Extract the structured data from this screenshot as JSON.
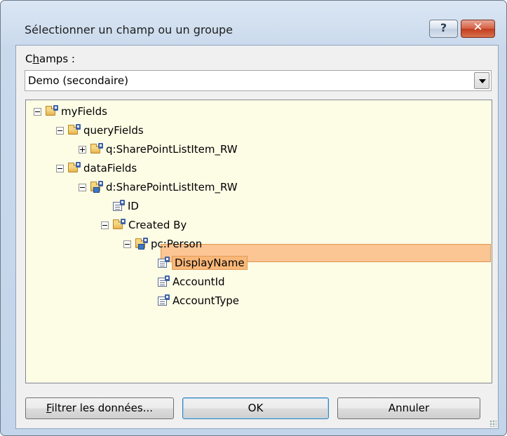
{
  "dialog": {
    "title": "Sélectionner un champ ou un groupe",
    "help_label": "?",
    "close_label": "✕"
  },
  "fields": {
    "label_prefix": "C",
    "label_underlined": "h",
    "label_suffix": "amps :",
    "selected_source": "Demo (secondaire)"
  },
  "tree": {
    "nodes": [
      {
        "label": "myFields",
        "level": 0,
        "expander": "minus",
        "icon": "folder-icon"
      },
      {
        "label": "queryFields",
        "level": 1,
        "expander": "minus",
        "icon": "folder-icon"
      },
      {
        "label": "q:SharePointListItem_RW",
        "level": 2,
        "expander": "plus",
        "icon": "folder-icon"
      },
      {
        "label": "dataFields",
        "level": 1,
        "expander": "minus",
        "icon": "folder-icon"
      },
      {
        "label": "d:SharePointListItem_RW",
        "level": 2,
        "expander": "minus",
        "icon": "folder-link-icon"
      },
      {
        "label": "ID",
        "level": 3,
        "expander": "none",
        "icon": "field-icon"
      },
      {
        "label": "Created By",
        "level": 3,
        "expander": "minus",
        "icon": "folder-icon"
      },
      {
        "label": "pc:Person",
        "level": 4,
        "expander": "minus",
        "icon": "folder-link-icon"
      },
      {
        "label": "DisplayName",
        "level": 5,
        "expander": "none",
        "icon": "field-icon",
        "selected": true
      },
      {
        "label": "AccountId",
        "level": 5,
        "expander": "none",
        "icon": "field-icon"
      },
      {
        "label": "AccountType",
        "level": 5,
        "expander": "none",
        "icon": "field-icon"
      }
    ]
  },
  "buttons": {
    "filter_first": "F",
    "filter_rest": "iltrer les données...",
    "ok": "OK",
    "cancel": "Annuler"
  }
}
